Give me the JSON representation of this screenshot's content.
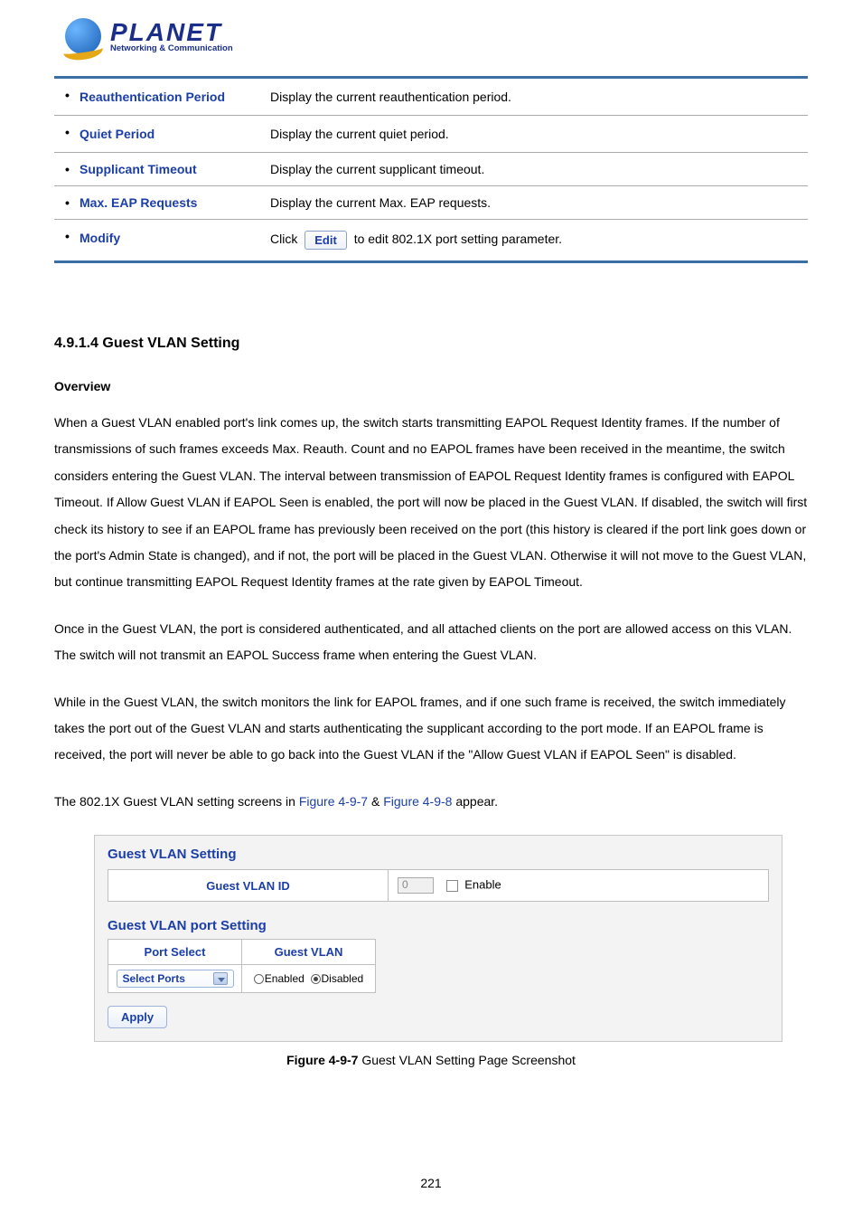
{
  "logo": {
    "brand": "PLANET",
    "tagline": "Networking & Communication"
  },
  "param_table": {
    "rows": [
      {
        "label": "Reauthentication Period",
        "value": "Display the current reauthentication period."
      },
      {
        "label": "Quiet Period",
        "value": "Display the current quiet period."
      },
      {
        "label": "Supplicant Timeout",
        "value": "Display the current supplicant timeout."
      },
      {
        "label": "Max. EAP Requests",
        "value": "Display the current Max. EAP requests."
      },
      {
        "label": "Modify",
        "prefix": "Click",
        "button": "Edit",
        "suffix": " to edit 802.1X port setting parameter."
      }
    ]
  },
  "section": {
    "heading": "4.9.1.4 Guest VLAN Setting",
    "subhead": "Overview",
    "para1": "When a Guest VLAN enabled port's link comes up, the switch starts transmitting EAPOL Request Identity frames. If the number of transmissions of such frames exceeds Max. Reauth. Count and no EAPOL frames have been received in the meantime, the switch considers entering the Guest VLAN. The interval between transmission of EAPOL Request Identity frames is configured with EAPOL Timeout. If Allow Guest VLAN if EAPOL Seen is enabled, the port will now be placed in the Guest VLAN. If disabled, the switch will first check its history to see if an EAPOL frame has previously been received on the port (this history is cleared if the port link goes down or the port's Admin State is changed), and if not, the port will be placed in the Guest VLAN. Otherwise it will not move to the Guest VLAN, but continue transmitting EAPOL Request Identity frames at the rate given by EAPOL Timeout.",
    "para2": "Once in the Guest VLAN, the port is considered authenticated, and all attached clients on the port are allowed access on this VLAN. The switch will not transmit an EAPOL Success frame when entering the Guest VLAN.",
    "para3": "While in the Guest VLAN, the switch monitors the link for EAPOL frames, and if one such frame is received, the switch immediately takes the port out of the Guest VLAN and starts authenticating the supplicant according to the port mode. If an EAPOL frame is received, the port will never be able to go back into the Guest VLAN if the \"Allow Guest VLAN if EAPOL Seen\" is disabled.",
    "refs_prefix": "The 802.1X Guest VLAN setting screens in ",
    "ref1": "Figure 4-9-7",
    "refs_mid": " & ",
    "ref2": "Figure 4-9-8",
    "refs_suffix": " appear."
  },
  "ui": {
    "title1": "Guest VLAN Setting",
    "gv_id_label": "Guest VLAN ID",
    "gv_id_value": "0",
    "enable_label": "Enable",
    "title2": "Guest VLAN port Setting",
    "col_port": "Port Select",
    "col_gv": "Guest VLAN",
    "select_ports": "Select Ports",
    "opt_enabled": "Enabled",
    "opt_disabled": "Disabled",
    "apply": "Apply"
  },
  "figure": {
    "num": "Figure 4-9-7",
    "caption": " Guest VLAN Setting Page Screenshot"
  },
  "page_number": "221"
}
